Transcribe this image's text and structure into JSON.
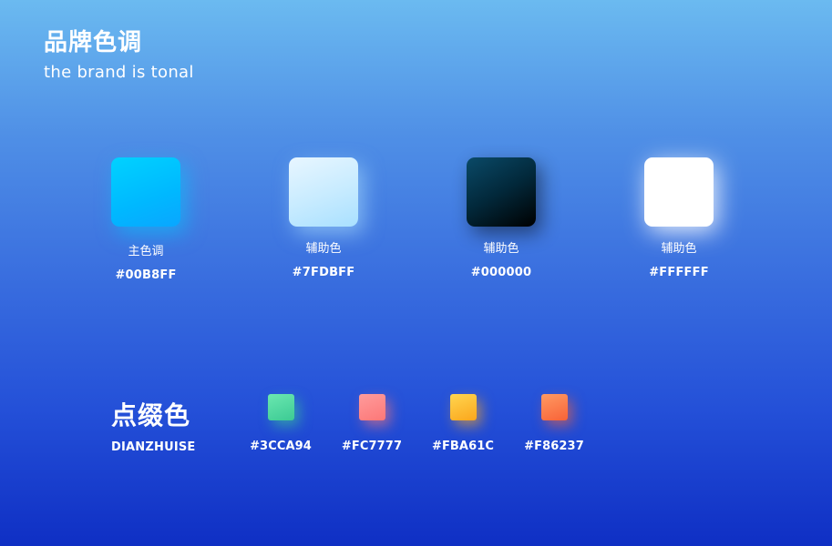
{
  "header": {
    "title": "品牌色调",
    "subtitle": "the brand is tonal"
  },
  "brand_colors": [
    {
      "label": "主色调",
      "hex": "#00B8FF",
      "color": "#00B8FF"
    },
    {
      "label": "辅助色",
      "hex": "#7FDBFF",
      "color": "#7FDBFF"
    },
    {
      "label": "辅助色",
      "hex": "#000000",
      "color": "#000000"
    },
    {
      "label": "辅助色",
      "hex": "#FFFFFF",
      "color": "#FFFFFF"
    }
  ],
  "accent_section": {
    "title": "点缀色",
    "subtitle": "DIANZHUISE",
    "colors": [
      {
        "hex": "#3CCA94",
        "color": "#3CCA94"
      },
      {
        "hex": "#FC7777",
        "color": "#FC7777"
      },
      {
        "hex": "#FBA61C",
        "color": "#FBA61C"
      },
      {
        "hex": "#F86237",
        "color": "#F86237"
      }
    ]
  }
}
